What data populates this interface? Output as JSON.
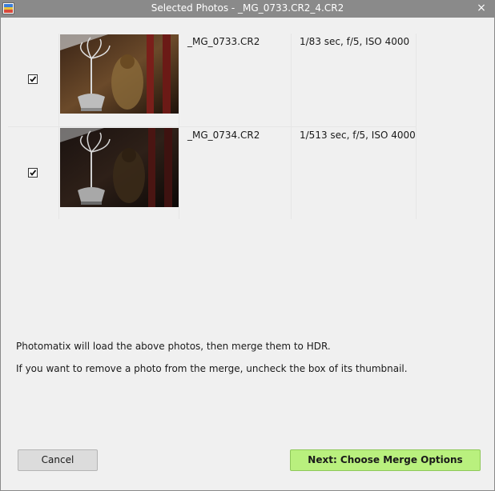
{
  "window": {
    "title": "Selected Photos - _MG_0733.CR2_4.CR2",
    "close_glyph": "×",
    "app_icon": "photomatix-app-icon",
    "close_icon": "close-icon"
  },
  "photos": [
    {
      "checked": true,
      "filename": "_MG_0733.CR2",
      "exposure": "1/83 sec, f/5, ISO 4000",
      "brightness": "normal"
    },
    {
      "checked": true,
      "filename": "_MG_0734.CR2",
      "exposure": "1/513 sec, f/5, ISO 4000",
      "brightness": "dark"
    }
  ],
  "info": {
    "line1": "Photomatix will load the above photos, then merge them to HDR.",
    "line2": "If you want to remove a photo from the merge, uncheck the box of its thumbnail."
  },
  "buttons": {
    "cancel": "Cancel",
    "next": "Next: Choose Merge Options"
  },
  "colors": {
    "titlebar": "#8a8a8a",
    "background": "#f0f0f0",
    "next_button": "#b9f07e",
    "cancel_button": "#dcdcdc"
  }
}
